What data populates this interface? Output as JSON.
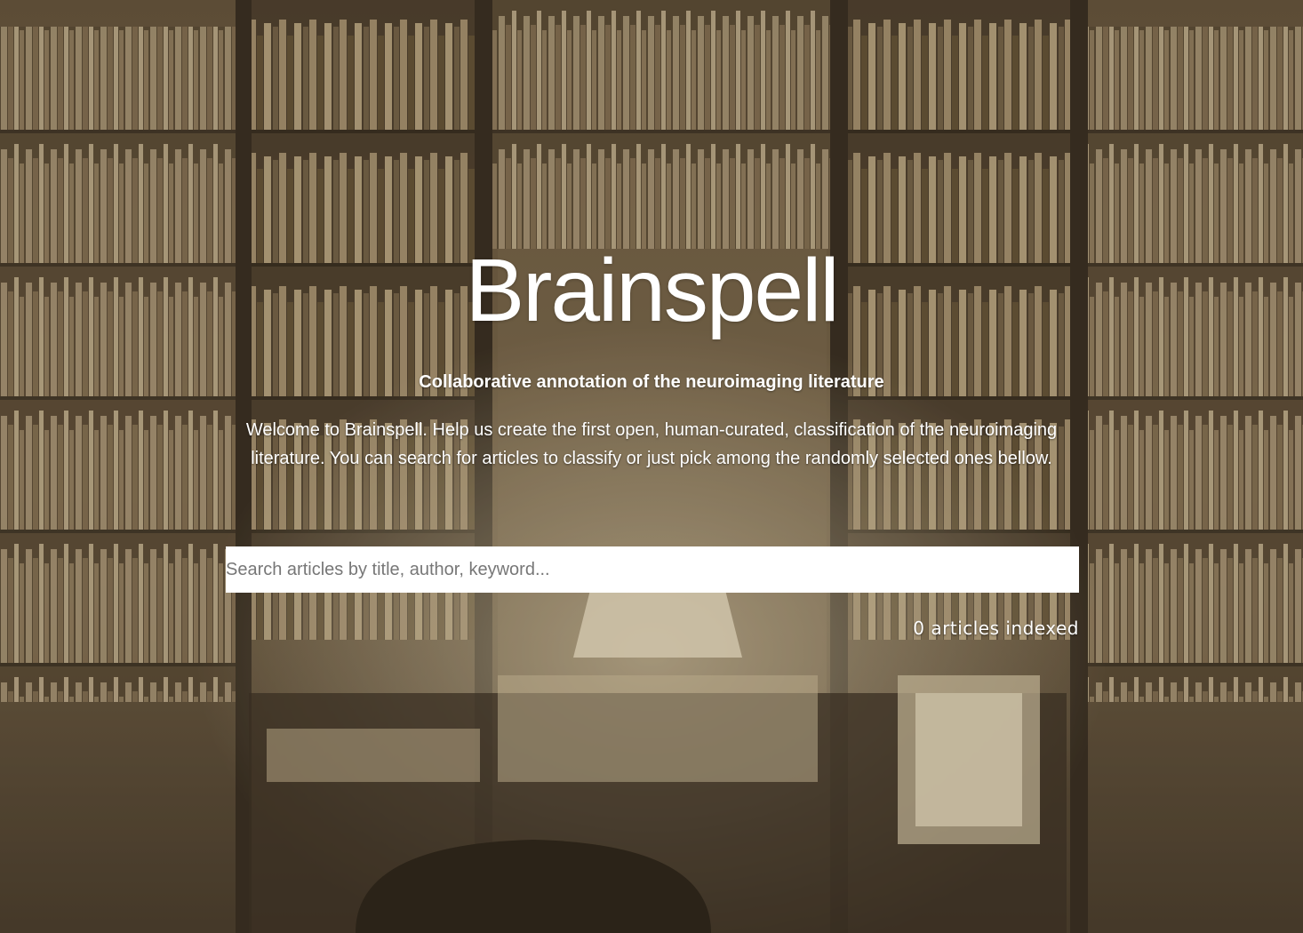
{
  "app": {
    "title": "Brainspell",
    "subtitle": "Collaborative annotation of the neuroimaging literature",
    "welcome": "Welcome to Brainspell. Help us create the first open, human-curated, classification of the neuroimaging literature. You can search for articles to classify or just pick among the randomly selected ones bellow."
  },
  "search": {
    "placeholder": "Search articles by title, author, keyword...",
    "value": ""
  },
  "stats": {
    "indexed_label": "0 articles indexed"
  },
  "colors": {
    "background_tone": "#4a3e2e",
    "text": "#ffffff",
    "search_bg": "#ffffff",
    "placeholder": "#777777"
  }
}
